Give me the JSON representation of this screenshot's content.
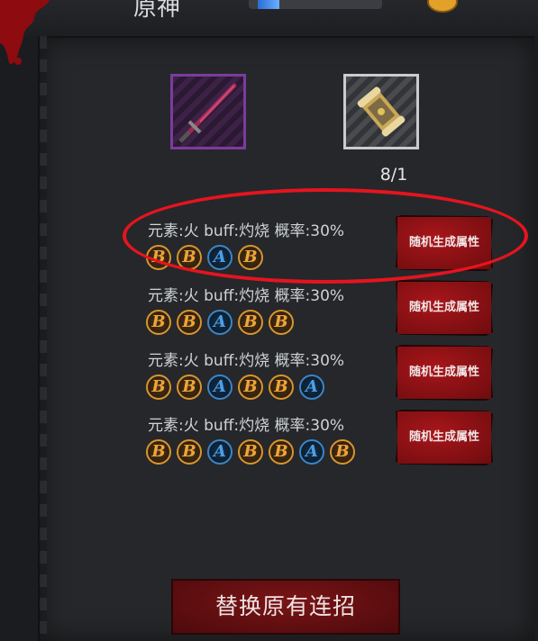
{
  "header": {
    "title": "原神"
  },
  "slots": {
    "weapon_icon": "sword-icon",
    "scroll_icon": "scroll-icon",
    "stack_count": "8/1"
  },
  "attributes": [
    {
      "text": "元素:火 buff:灼烧 概率:30%",
      "runes": [
        "B",
        "B",
        "A",
        "B"
      ],
      "button": "随机生成属性"
    },
    {
      "text": "元素:火 buff:灼烧 概率:30%",
      "runes": [
        "B",
        "B",
        "A",
        "B",
        "B"
      ],
      "button": "随机生成属性"
    },
    {
      "text": "元素:火 buff:灼烧 概率:30%",
      "runes": [
        "B",
        "B",
        "A",
        "B",
        "B",
        "A"
      ],
      "button": "随机生成属性"
    },
    {
      "text": "元素:火 buff:灼烧 概率:30%",
      "runes": [
        "B",
        "B",
        "A",
        "B",
        "B",
        "A",
        "B"
      ],
      "button": "随机生成属性"
    }
  ],
  "footer": {
    "replace_label": "替换原有连招"
  },
  "colors": {
    "panel": "#26272a",
    "accent_red": "#e5141f",
    "rune_b": "#d8952f",
    "rune_a": "#3a86c8",
    "weapon_border": "#7d3aa0"
  }
}
